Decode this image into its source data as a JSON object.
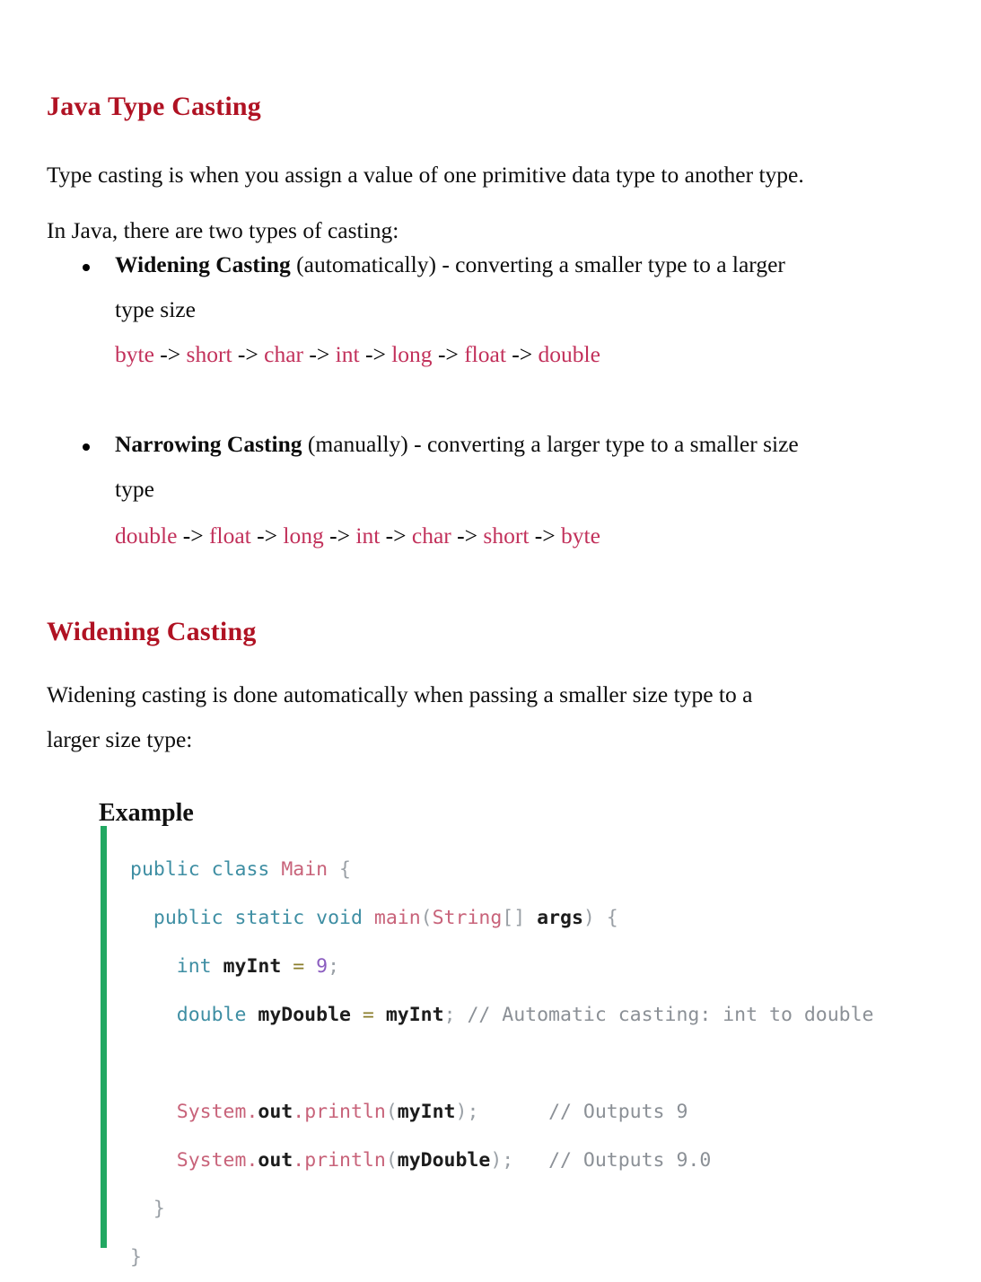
{
  "document": {
    "title": "Java Type Casting",
    "intro_paragraphs": [
      "Type casting is when you assign a value of one primitive data type to another type.",
      "In Java, there are two types of casting:"
    ],
    "casting_types": [
      {
        "name": "Widening Casting",
        "qualifier": "(automatically)",
        "description": " - converting a smaller type to a larger",
        "description_cont": "type size",
        "chain": [
          "byte",
          "short",
          "char",
          "int",
          "long",
          "float",
          "double"
        ],
        "arrow": "->"
      },
      {
        "name": "Narrowing Casting",
        "qualifier": "(manually)",
        "description": " - converting a larger type to a smaller size",
        "description_cont": "type",
        "chain": [
          "double",
          "float",
          "long",
          "int",
          "char",
          "short",
          "byte"
        ],
        "arrow": "->"
      }
    ],
    "section": {
      "heading": "Widening Casting",
      "paragraph_line1": "Widening casting is done automatically when passing a smaller size type to a",
      "paragraph_line2": "larger size type:"
    },
    "example": {
      "heading": "Example",
      "code_lines": [
        {
          "indent": 0,
          "tokens": [
            {
              "t": "kw",
              "v": "public"
            },
            {
              "t": "pun",
              "v": " "
            },
            {
              "t": "kw",
              "v": "class"
            },
            {
              "t": "pun",
              "v": " "
            },
            {
              "t": "cls",
              "v": "Main"
            },
            {
              "t": "pun",
              "v": " {"
            }
          ]
        },
        {
          "indent": 2,
          "tokens": [
            {
              "t": "kw",
              "v": "public"
            },
            {
              "t": "pun",
              "v": " "
            },
            {
              "t": "kw",
              "v": "static"
            },
            {
              "t": "pun",
              "v": " "
            },
            {
              "t": "kw",
              "v": "void"
            },
            {
              "t": "pun",
              "v": " "
            },
            {
              "t": "fn",
              "v": "main"
            },
            {
              "t": "pun",
              "v": "("
            },
            {
              "t": "cls",
              "v": "String"
            },
            {
              "t": "pun",
              "v": "[] "
            },
            {
              "t": "id",
              "v": "args"
            },
            {
              "t": "pun",
              "v": ") {"
            }
          ]
        },
        {
          "indent": 4,
          "tokens": [
            {
              "t": "kw",
              "v": "int"
            },
            {
              "t": "pun",
              "v": " "
            },
            {
              "t": "id",
              "v": "myInt"
            },
            {
              "t": "pun",
              "v": " "
            },
            {
              "t": "op",
              "v": "="
            },
            {
              "t": "pun",
              "v": " "
            },
            {
              "t": "num",
              "v": "9"
            },
            {
              "t": "pun",
              "v": ";"
            }
          ]
        },
        {
          "indent": 4,
          "tokens": [
            {
              "t": "kw",
              "v": "double"
            },
            {
              "t": "pun",
              "v": " "
            },
            {
              "t": "id",
              "v": "myDouble"
            },
            {
              "t": "pun",
              "v": " "
            },
            {
              "t": "op",
              "v": "="
            },
            {
              "t": "pun",
              "v": " "
            },
            {
              "t": "id",
              "v": "myInt"
            },
            {
              "t": "pun",
              "v": "; "
            },
            {
              "t": "cmt",
              "v": "// Automatic casting: int to double"
            }
          ]
        },
        {
          "indent": 0,
          "tokens": []
        },
        {
          "indent": 4,
          "tokens": [
            {
              "t": "cls",
              "v": "System"
            },
            {
              "t": "fn",
              "v": "."
            },
            {
              "t": "id",
              "v": "out"
            },
            {
              "t": "fn",
              "v": "."
            },
            {
              "t": "fn",
              "v": "println"
            },
            {
              "t": "pun",
              "v": "("
            },
            {
              "t": "id",
              "v": "myInt"
            },
            {
              "t": "pun",
              "v": ");"
            },
            {
              "t": "pun",
              "v": "      "
            },
            {
              "t": "cmt",
              "v": "// Outputs 9"
            }
          ]
        },
        {
          "indent": 4,
          "tokens": [
            {
              "t": "cls",
              "v": "System"
            },
            {
              "t": "fn",
              "v": "."
            },
            {
              "t": "id",
              "v": "out"
            },
            {
              "t": "fn",
              "v": "."
            },
            {
              "t": "fn",
              "v": "println"
            },
            {
              "t": "pun",
              "v": "("
            },
            {
              "t": "id",
              "v": "myDouble"
            },
            {
              "t": "pun",
              "v": ");"
            },
            {
              "t": "pun",
              "v": "   "
            },
            {
              "t": "cmt",
              "v": "// Outputs 9.0"
            }
          ]
        },
        {
          "indent": 2,
          "tokens": [
            {
              "t": "pun",
              "v": "}"
            }
          ]
        },
        {
          "indent": 0,
          "tokens": [
            {
              "t": "pun",
              "v": "}"
            }
          ]
        }
      ]
    },
    "colors": {
      "heading_red": "#b01223",
      "type_chain_red": "#c2315b",
      "code_rail_green": "#22a862",
      "keyword_blue": "#3e8ea3",
      "class_pink": "#c8637a",
      "comment_gray": "#8b9096",
      "number_purple": "#8a5cbf",
      "operator_olive": "#8a7c2a"
    }
  }
}
